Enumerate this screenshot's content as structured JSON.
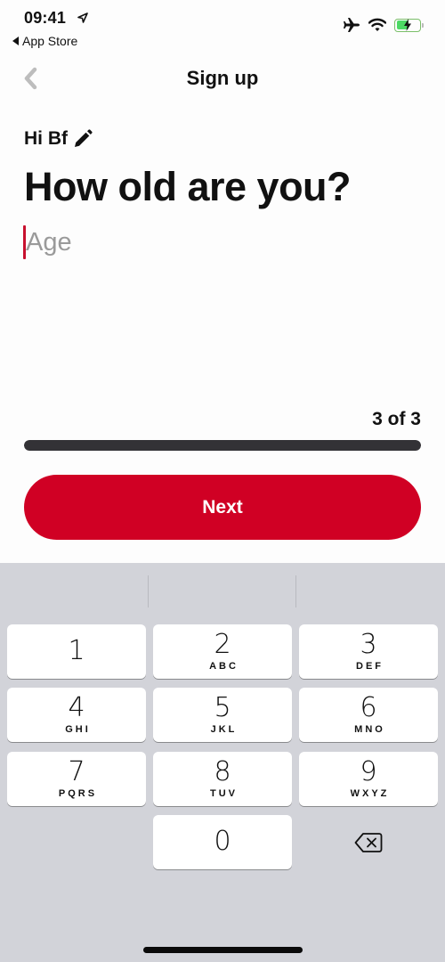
{
  "status_bar": {
    "time": "09:41",
    "back_app": "App Store",
    "icons": [
      "location-arrow-icon",
      "airplane-icon",
      "wifi-icon",
      "battery-charging-icon"
    ]
  },
  "nav": {
    "title": "Sign up",
    "back_icon": "chevron-left-icon"
  },
  "greeting": {
    "text": "Hi Bf",
    "edit_icon": "pencil-icon"
  },
  "question": "How old are you?",
  "age_input": {
    "value": "",
    "placeholder": "Age"
  },
  "progress": {
    "label": "3 of 3",
    "current": 3,
    "total": 3,
    "fraction": 1.0
  },
  "next_button": {
    "label": "Next"
  },
  "colors": {
    "accent": "#d00024",
    "progress_bar": "#333236",
    "keyboard_bg": "#d2d3d9",
    "caret": "#c8102e"
  },
  "keypad": {
    "keys": [
      {
        "num": "1",
        "letters": ""
      },
      {
        "num": "2",
        "letters": "ABC"
      },
      {
        "num": "3",
        "letters": "DEF"
      },
      {
        "num": "4",
        "letters": "GHI"
      },
      {
        "num": "5",
        "letters": "JKL"
      },
      {
        "num": "6",
        "letters": "MNO"
      },
      {
        "num": "7",
        "letters": "PQRS"
      },
      {
        "num": "8",
        "letters": "TUV"
      },
      {
        "num": "9",
        "letters": "WXYZ"
      },
      {
        "num": "0",
        "letters": ""
      }
    ],
    "delete_icon": "backspace-icon"
  }
}
